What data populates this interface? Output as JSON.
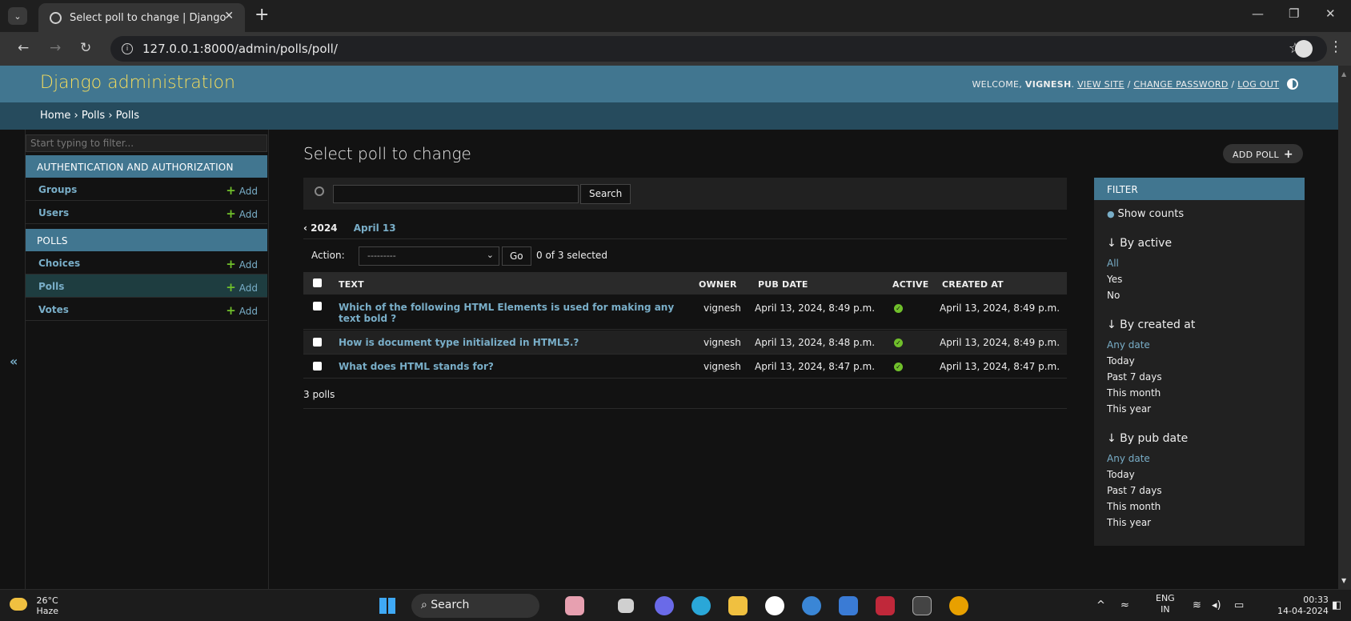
{
  "browser": {
    "tab_title": "Select poll to change | Django s",
    "url": "127.0.0.1:8000/admin/polls/poll/"
  },
  "header": {
    "branding": "Django administration",
    "welcome": "WELCOME, ",
    "username": "VIGNESH",
    "view_site": "VIEW SITE",
    "change_password": "CHANGE PASSWORD",
    "log_out": "LOG OUT",
    "sep": " / "
  },
  "breadcrumbs": "Home › Polls › Polls",
  "sidebar": {
    "filter_placeholder": "Start typing to filter...",
    "add_label": "Add",
    "modules": [
      {
        "caption": "AUTHENTICATION AND AUTHORIZATION",
        "models": [
          "Groups",
          "Users"
        ]
      },
      {
        "caption": "POLLS",
        "models": [
          "Choices",
          "Polls",
          "Votes"
        ]
      }
    ]
  },
  "content": {
    "title": "Select poll to change",
    "add_button": "ADD POLL",
    "search_button": "Search",
    "date_back": "‹ 2024",
    "date_current": "April 13",
    "action_label": "Action:",
    "action_select": "---------",
    "go_button": "Go",
    "selection_count": "0 of 3 selected",
    "columns": [
      "TEXT",
      "OWNER",
      "PUB DATE",
      "ACTIVE",
      "CREATED AT"
    ],
    "rows": [
      {
        "text": "Which of the following HTML Elements is used for making any text bold ?",
        "owner": "vignesh",
        "pub_date": "April 13, 2024, 8:49 p.m.",
        "active": true,
        "created_at": "April 13, 2024, 8:49 p.m."
      },
      {
        "text": "How is document type initialized in HTML5.?",
        "owner": "vignesh",
        "pub_date": "April 13, 2024, 8:48 p.m.",
        "active": true,
        "created_at": "April 13, 2024, 8:49 p.m."
      },
      {
        "text": "What does HTML stands for?",
        "owner": "vignesh",
        "pub_date": "April 13, 2024, 8:47 p.m.",
        "active": true,
        "created_at": "April 13, 2024, 8:47 p.m."
      }
    ],
    "paginator": "3 polls"
  },
  "filter": {
    "title": "FILTER",
    "show_counts": "Show counts",
    "groups": [
      {
        "title": "↓ By active",
        "options": [
          "All",
          "Yes",
          "No"
        ],
        "selected": 0
      },
      {
        "title": "↓ By created at",
        "options": [
          "Any date",
          "Today",
          "Past 7 days",
          "This month",
          "This year"
        ],
        "selected": 0
      },
      {
        "title": "↓ By pub date",
        "options": [
          "Any date",
          "Today",
          "Past 7 days",
          "This month",
          "This year"
        ],
        "selected": 0
      }
    ]
  },
  "taskbar": {
    "temperature": "26°C",
    "weather": "Haze",
    "search": "Search",
    "language": "ENG",
    "region": "IN",
    "time": "00:33",
    "date": "14-04-2024"
  },
  "colors": {
    "header": "#417690",
    "branding": "#f5dd5d",
    "link": "#79aec8",
    "add_icon": "#70bf2b"
  }
}
